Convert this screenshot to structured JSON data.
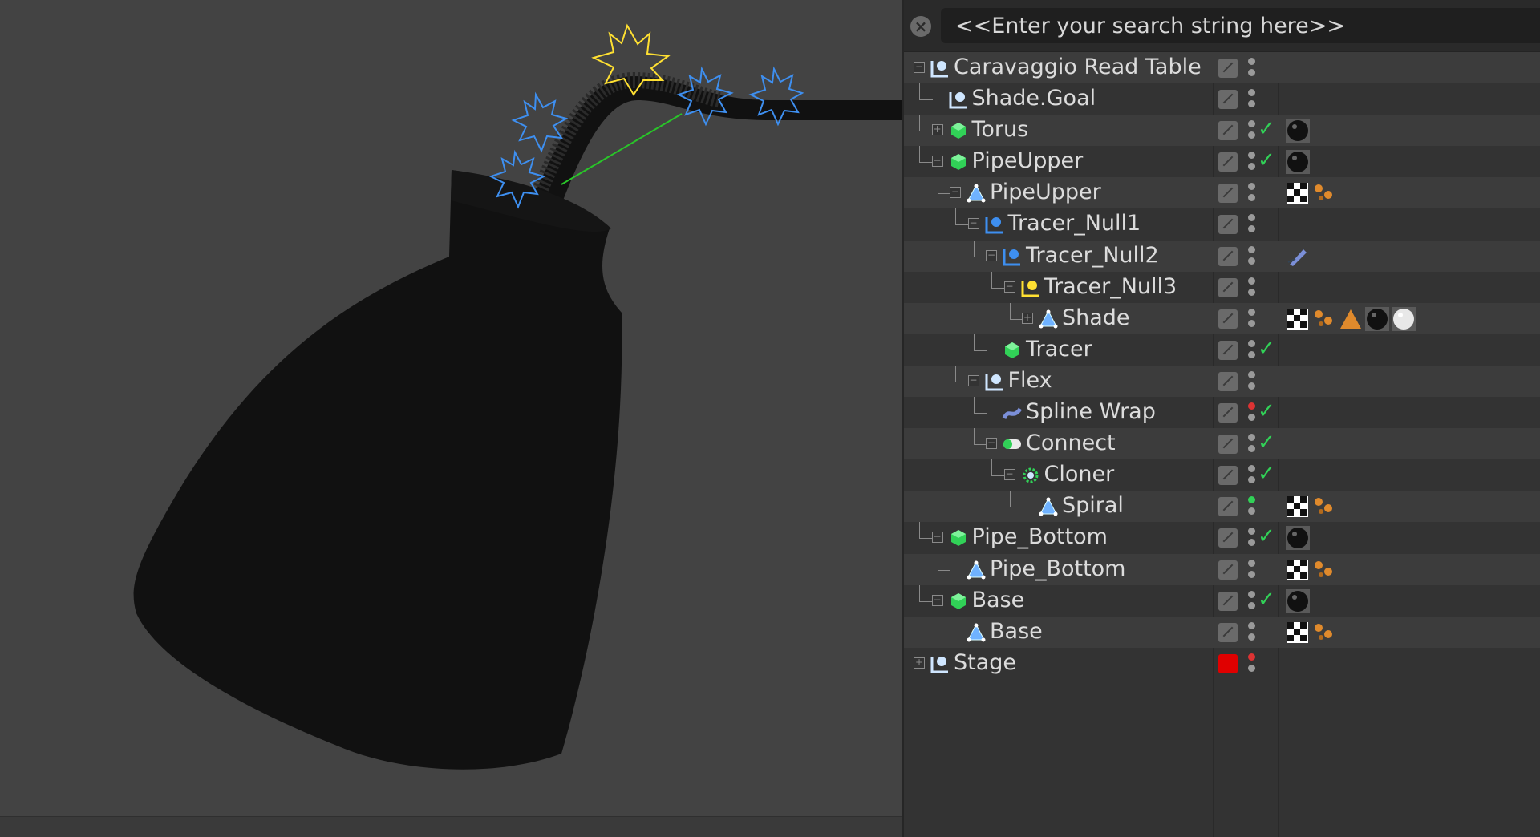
{
  "search": {
    "placeholder": "<<Enter your search string here>>"
  },
  "objects": [
    {
      "name": "Caravaggio Read Table",
      "depth": 0,
      "icon": "null-object-icon",
      "expander": "minus",
      "layer": "gray",
      "vis": [
        "gray",
        "gray"
      ],
      "enabled": false,
      "tags": []
    },
    {
      "name": "Shade.Goal",
      "depth": 1,
      "icon": "null-object-icon",
      "expander": "none",
      "layer": "gray",
      "vis": [
        "gray",
        "gray"
      ],
      "enabled": false,
      "tags": []
    },
    {
      "name": "Torus",
      "depth": 1,
      "icon": "polygon-object-icon",
      "expander": "plus",
      "layer": "gray",
      "vis": [
        "gray",
        "gray"
      ],
      "enabled": true,
      "tags": [
        "material-black-icon"
      ]
    },
    {
      "name": "PipeUpper",
      "depth": 1,
      "icon": "polygon-object-icon",
      "expander": "minus",
      "layer": "gray",
      "vis": [
        "gray",
        "gray"
      ],
      "enabled": true,
      "tags": [
        "material-black-icon"
      ]
    },
    {
      "name": "PipeUpper",
      "depth": 2,
      "icon": "polygon-mesh-icon",
      "expander": "minus",
      "layer": "gray",
      "vis": [
        "gray",
        "gray"
      ],
      "enabled": false,
      "tags": [
        "texture-tag-icon",
        "selection-tag-icon"
      ]
    },
    {
      "name": "Tracer_Null1",
      "depth": 3,
      "icon": "null-object-blue-icon",
      "expander": "minus",
      "layer": "gray",
      "vis": [
        "gray",
        "gray"
      ],
      "enabled": false,
      "tags": []
    },
    {
      "name": "Tracer_Null2",
      "depth": 4,
      "icon": "null-object-blue-icon",
      "expander": "minus",
      "layer": "gray",
      "vis": [
        "gray",
        "gray"
      ],
      "enabled": false,
      "tags": [
        "pen-tag-icon"
      ]
    },
    {
      "name": "Tracer_Null3",
      "depth": 5,
      "icon": "null-object-yellow-icon",
      "expander": "minus",
      "layer": "gray",
      "vis": [
        "gray",
        "gray"
      ],
      "enabled": false,
      "tags": []
    },
    {
      "name": "Shade",
      "depth": 6,
      "icon": "polygon-mesh-icon",
      "expander": "plus",
      "layer": "gray",
      "vis": [
        "gray",
        "gray"
      ],
      "enabled": false,
      "tags": [
        "texture-tag-icon",
        "selection-tag-icon",
        "phong-tag-icon",
        "material-black-icon",
        "material-white-icon"
      ]
    },
    {
      "name": "Tracer",
      "depth": 4,
      "icon": "tracer-object-icon",
      "expander": "none",
      "layer": "gray",
      "vis": [
        "gray",
        "gray"
      ],
      "enabled": true,
      "tags": []
    },
    {
      "name": "Flex",
      "depth": 3,
      "icon": "null-object-icon",
      "expander": "minus",
      "layer": "gray",
      "vis": [
        "gray",
        "gray"
      ],
      "enabled": false,
      "tags": []
    },
    {
      "name": "Spline Wrap",
      "depth": 4,
      "icon": "spline-wrap-icon",
      "expander": "none",
      "layer": "gray",
      "vis": [
        "red",
        "gray"
      ],
      "enabled": true,
      "tags": []
    },
    {
      "name": "Connect",
      "depth": 4,
      "icon": "connect-object-icon",
      "expander": "minus",
      "layer": "gray",
      "vis": [
        "gray",
        "gray"
      ],
      "enabled": true,
      "tags": []
    },
    {
      "name": "Cloner",
      "depth": 5,
      "icon": "cloner-object-icon",
      "expander": "minus",
      "layer": "gray",
      "vis": [
        "gray",
        "gray"
      ],
      "enabled": true,
      "tags": []
    },
    {
      "name": "Spiral",
      "depth": 6,
      "icon": "polygon-mesh-icon",
      "expander": "none",
      "layer": "gray",
      "vis": [
        "green",
        "gray"
      ],
      "enabled": false,
      "tags": [
        "texture-tag-icon",
        "selection-tag-icon"
      ]
    },
    {
      "name": "Pipe_Bottom",
      "depth": 1,
      "icon": "polygon-object-icon",
      "expander": "minus",
      "layer": "gray",
      "vis": [
        "gray",
        "gray"
      ],
      "enabled": true,
      "tags": [
        "material-black-icon"
      ]
    },
    {
      "name": "Pipe_Bottom",
      "depth": 2,
      "icon": "polygon-mesh-icon",
      "expander": "none",
      "layer": "gray",
      "vis": [
        "gray",
        "gray"
      ],
      "enabled": false,
      "tags": [
        "texture-tag-icon",
        "selection-tag-icon"
      ]
    },
    {
      "name": "Base",
      "depth": 1,
      "icon": "polygon-object-icon",
      "expander": "minus",
      "layer": "gray",
      "vis": [
        "gray",
        "gray"
      ],
      "enabled": true,
      "tags": [
        "material-black-icon"
      ]
    },
    {
      "name": "Base",
      "depth": 2,
      "icon": "polygon-mesh-icon",
      "expander": "none",
      "layer": "gray",
      "vis": [
        "gray",
        "gray"
      ],
      "enabled": false,
      "tags": [
        "texture-tag-icon",
        "selection-tag-icon"
      ]
    },
    {
      "name": "Stage",
      "depth": 0,
      "icon": "null-object-icon",
      "expander": "plus",
      "layer": "red",
      "vis": [
        "red",
        "gray"
      ],
      "enabled": false,
      "tags": []
    }
  ],
  "colors": {
    "viewport_bg": "#434343",
    "panel_bg": "#333333",
    "row_alt": "#3c3c3c",
    "check_green": "#31d157",
    "layer_red": "#e00000"
  }
}
